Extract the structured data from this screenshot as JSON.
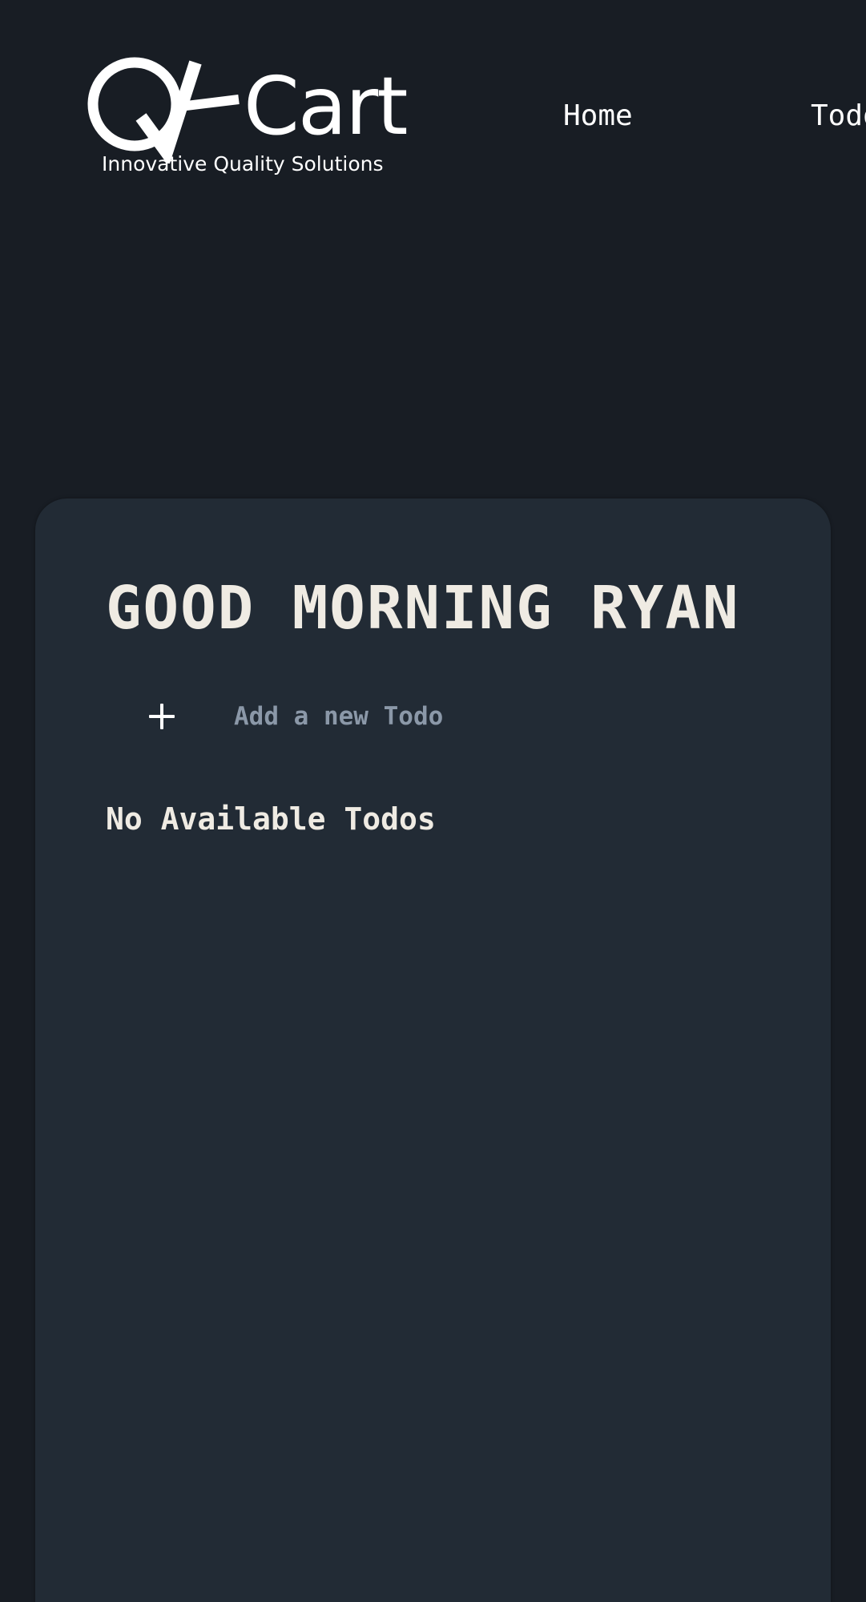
{
  "header": {
    "logo": {
      "wordmark": "Cart",
      "tagline": "Innovative Quality Solutions"
    },
    "nav": {
      "home_label": "Home",
      "todo_label": "Todo"
    }
  },
  "main": {
    "greeting": "GOOD MORNING RYAN",
    "add_todo": {
      "placeholder": "Add a new Todo",
      "value": "",
      "add_icon": "plus-icon"
    },
    "empty_message": "No Available Todos"
  },
  "colors": {
    "page_background": "#181d24",
    "card_background": "#222b35",
    "heading_text": "#efebe3",
    "placeholder_text": "#8b98a8",
    "nav_text": "#ffffff"
  }
}
